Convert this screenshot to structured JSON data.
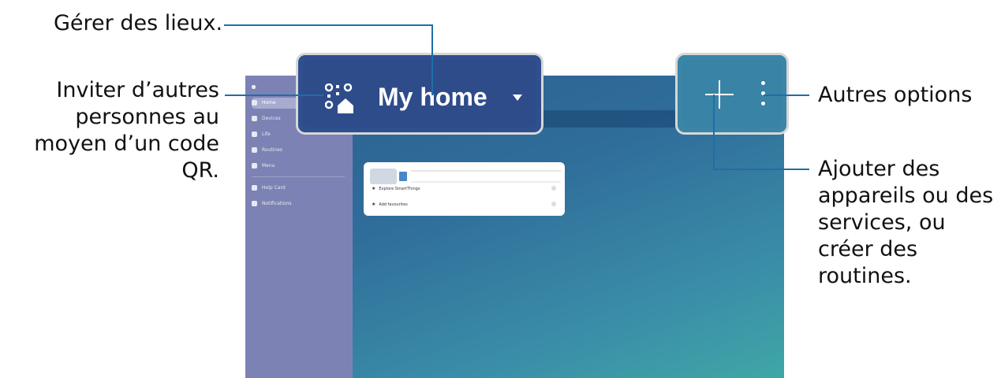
{
  "callouts": {
    "manage_places": "Gérer des lieux.",
    "invite_qr": "Inviter d’autres personnes au moyen d’un code QR.",
    "more_options": "Autres options",
    "add_devices": "Ajouter des appareils ou des services, ou créer des routines."
  },
  "header": {
    "title": "My home",
    "qr_icon": "qr-home-icon",
    "dropdown_icon": "caret-down-icon"
  },
  "actions": {
    "add_icon": "plus-icon",
    "more_icon": "more-vertical-icon"
  },
  "sidebar": {
    "items": [
      "Home",
      "Devices",
      "Life",
      "Routines",
      "Menu",
      "Help Card",
      "Notifications"
    ]
  },
  "card": {
    "rows": [
      "Explore SmartThings",
      "Add favourites"
    ]
  },
  "colors": {
    "callout_line": "#1f6ea9",
    "header_bg": "#2e4c8a",
    "actions_bg": "#3883a6",
    "sidebar_bg": "#7d82b4"
  }
}
